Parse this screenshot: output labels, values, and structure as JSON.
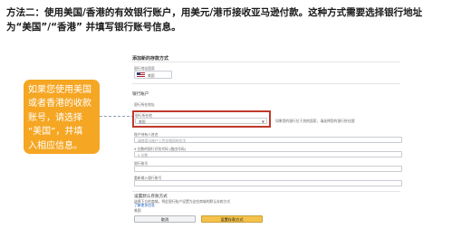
{
  "heading": {
    "line1": "方法二：使用美国/香港的有效银行账户，用美元/港币接收亚马逊付款。这种方式需要选择银行地址",
    "line2": "为“美国”/“香港” 并填写银行账号信息。"
  },
  "callout": {
    "lines": [
      "如果您使用美国",
      "或者香港的收款",
      "账号，请选择",
      "“美国”，并填",
      "入相应信息。"
    ]
  },
  "form": {
    "title": "添加新的存款方式",
    "sub_label": "银行地址国家",
    "country_value": "美国",
    "colors": {
      "highlight": "#c0392b",
      "callout": "#f5a623",
      "primary_button": "#f4c24a"
    },
    "bank_account_section": "银行账户",
    "bank_location_label": "银行所在地址",
    "bank_location_field_label": "银行所在地",
    "bank_location_value": "美国",
    "bank_location_hint": "如果您的银行位于其他国家，请选择您的银行所在国家",
    "account_holder_label": "账户持有人姓名",
    "account_holder_placeholder": "请使用与账户上完全相同的名字",
    "routing_label": "9 位数的银行识别代码 (路由号码)",
    "routing_placeholder": "9 位数",
    "account_number_label": "银行账号",
    "reenter_label": "重新输入银行账号",
    "set_default_title": "设置默认存款方式",
    "set_default_desc": "选择下方的商城，将此银行账户设置为这些商城的默认存款方式",
    "set_default_link": "了解更多信息",
    "market_label": "美国",
    "cancel_label": "取消",
    "submit_label": "设置存款方式"
  }
}
